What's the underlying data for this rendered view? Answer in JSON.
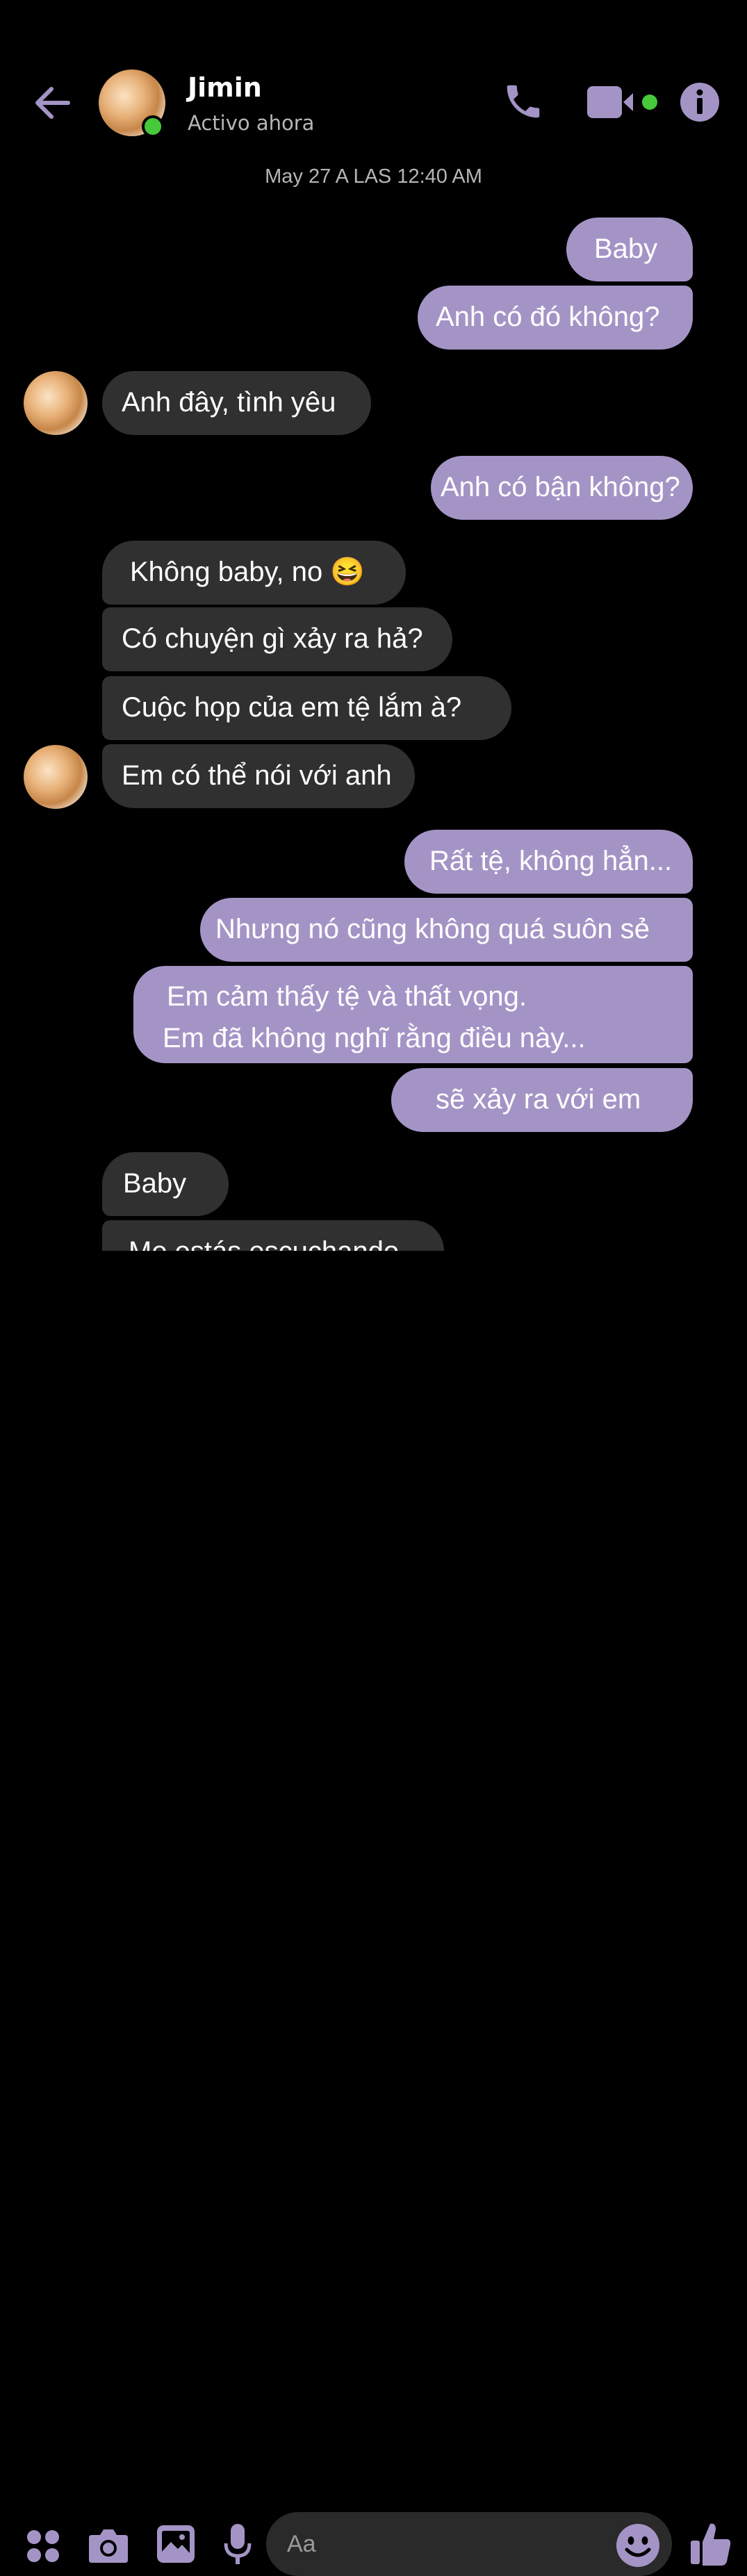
{
  "header": {
    "contact_name": "Jimin",
    "status": "Activo ahora",
    "icons": [
      "back-arrow-icon",
      "phone-icon",
      "video-camera-icon",
      "info-icon"
    ]
  },
  "date_separator": "May 27 A LAS 12:40 AM",
  "messages": [
    {
      "from": "me",
      "text": "Baby"
    },
    {
      "from": "me",
      "text": "Anh có đó không?"
    },
    {
      "from": "them",
      "text": "Anh đây, tình yêu"
    },
    {
      "from": "me",
      "text": "Anh có bận không?"
    },
    {
      "from": "them",
      "text": "Không baby, no 😆"
    },
    {
      "from": "them",
      "text": "Có chuyện gì xảy ra hả?"
    },
    {
      "from": "them",
      "text": "Cuộc họp của em tệ lắm à?"
    },
    {
      "from": "them",
      "text": "Em có thể nói với anh"
    },
    {
      "from": "me",
      "text": "Rất tệ, không hẳn..."
    },
    {
      "from": "me",
      "text": "Nhưng nó cũng không quá suôn sẻ"
    },
    {
      "from": "me",
      "line1": "Em cảm thấy tệ và thất vọng.",
      "line2": "Em đã không nghĩ rằng điều này..."
    },
    {
      "from": "me",
      "text": "sẽ xảy ra với em"
    },
    {
      "from": "them",
      "text": "Baby"
    },
    {
      "from": "them",
      "text": "Me estás escuchando"
    }
  ],
  "composer": {
    "placeholder": "Aa",
    "icons": [
      "apps-grid-icon",
      "camera-icon",
      "gallery-icon",
      "microphone-icon",
      "emoji-icon",
      "thumbs-up-icon"
    ]
  },
  "colors": {
    "accent": "#a494c6",
    "outgoing_bubble": "#a494c6",
    "incoming_bubble": "#303030",
    "online": "#46c93a",
    "background": "#000000"
  }
}
